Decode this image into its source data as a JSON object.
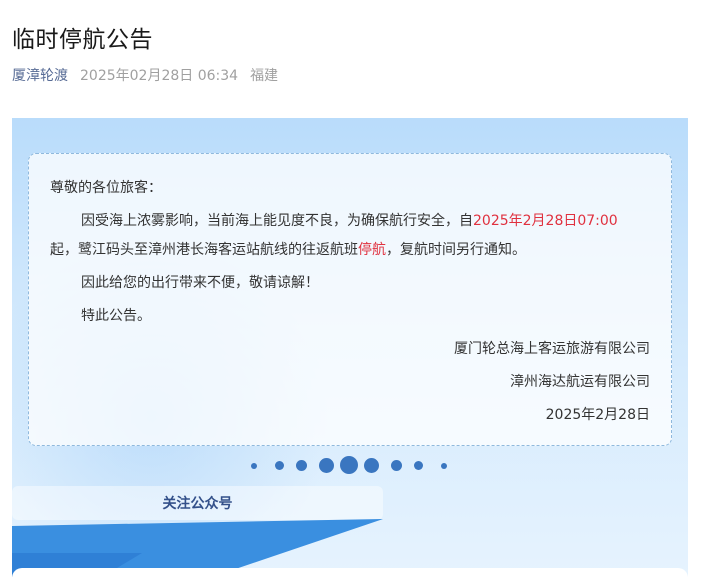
{
  "article": {
    "title": "临时停航公告",
    "account": "厦漳轮渡",
    "date": "2025年02月28日 06:34",
    "region": "福建"
  },
  "notice": {
    "greeting": "尊敬的各位旅客：",
    "line1_prefix": "因受海上浓雾影响，当前海上能见度不良，为确保航行安全，自",
    "line1_time": "2025年2月28日07:00",
    "line2_prefix": "起，鹭江码头至漳州港长海客运站航线的往返航班",
    "line2_status": "停航",
    "line2_suffix": "，复航时间另行通知。",
    "line3": "因此给您的出行带来不便，敬请谅解！",
    "line4": "特此公告。",
    "signature1": "厦门轮总海上客运旅游有限公司",
    "signature2": "漳州海达航运有限公司",
    "signature_date": "2025年2月28日"
  },
  "follow_button": "关注公众号",
  "colors": {
    "accent_link": "#576b95",
    "highlight_red": "#e0313f",
    "dot_blue": "#3a76c0",
    "stripe_blue": "#3a8fe0"
  }
}
